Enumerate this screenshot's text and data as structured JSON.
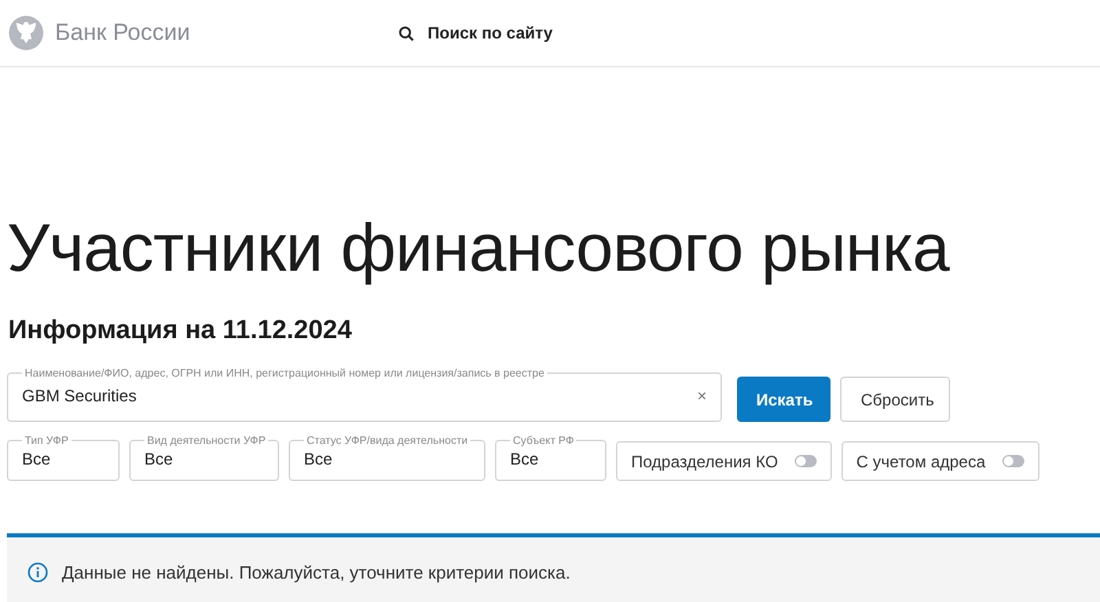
{
  "header": {
    "brand": "Банк России",
    "search_link": "Поиск по сайту"
  },
  "title": "Участники финансового рынка",
  "subtitle": "Информация на 11.12.2024",
  "search": {
    "label": "Наименование/ФИО, адрес, ОГРН или ИНН, регистрационный номер или лицензия/запись в реестре",
    "value": "GBM Securities",
    "clear": "×"
  },
  "buttons": [
    {
      "label": "Искать",
      "kind": "primary"
    },
    {
      "label": "Сбросить",
      "kind": "secondary"
    }
  ],
  "filters": [
    {
      "kind": "select",
      "label": "Тип УФР",
      "value": "Все"
    },
    {
      "kind": "select",
      "label": "Вид деятельности УФР",
      "value": "Все"
    },
    {
      "kind": "select",
      "label": "Статус УФР/вида деятельности",
      "value": "Все"
    },
    {
      "kind": "select",
      "label": "Субъект РФ",
      "value": "Все"
    },
    {
      "kind": "toggle",
      "label": "Подразделения КО",
      "on": false
    },
    {
      "kind": "toggle",
      "label": "С учетом адреса",
      "on": false
    }
  ],
  "alert": {
    "text": "Данные не найдены. Пожалуйста, уточните критерии поиска."
  }
}
